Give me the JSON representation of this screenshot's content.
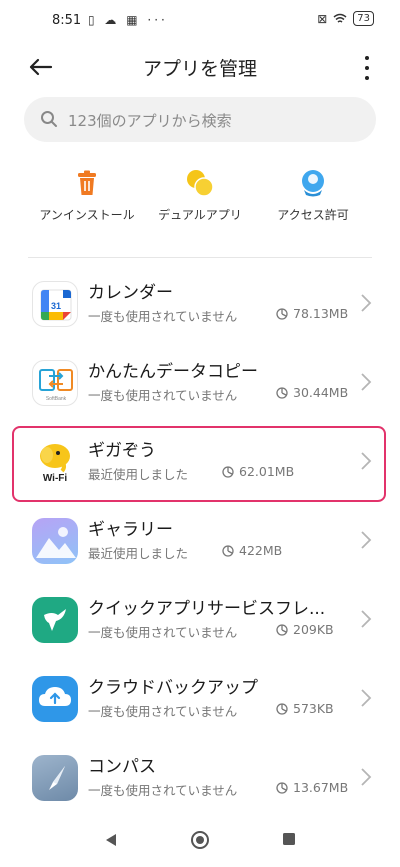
{
  "status_bar": {
    "time": "8:51",
    "left_icons": "▯ ☁ ▦ ···",
    "battery": "73"
  },
  "header": {
    "title": "アプリを管理"
  },
  "search": {
    "placeholder": "123個のアプリから検索"
  },
  "quick_actions": [
    {
      "label": "アンインストール",
      "icon": "trash-icon",
      "color": "#f07a22"
    },
    {
      "label": "デュアルアプリ",
      "icon": "dual-circles-icon",
      "color": "#f5c518"
    },
    {
      "label": "アクセス許可",
      "icon": "access-badge-icon",
      "color": "#3fa7ee"
    }
  ],
  "apps": [
    {
      "name": "カレンダー",
      "last_used": "一度も使用されていません",
      "size": "78.13MB",
      "icon": "calendar-app-icon",
      "icon_text": "31"
    },
    {
      "name": "かんたんデータコピー",
      "last_used": "一度も使用されていません",
      "size": "30.44MB",
      "icon": "data-copy-app-icon",
      "icon_text": "SoftBank"
    },
    {
      "name": "ギガぞう",
      "last_used": "最近使用しました",
      "size": "62.01MB",
      "icon": "gigazou-app-icon",
      "icon_text": "Wi-Fi"
    },
    {
      "name": "ギャラリー",
      "last_used": "最近使用しました",
      "size": "422MB",
      "icon": "gallery-app-icon"
    },
    {
      "name": "クイックアプリサービスフレ...",
      "last_used": "一度も使用されていません",
      "size": "209KB",
      "icon": "quick-app-icon"
    },
    {
      "name": "クラウドバックアップ",
      "last_used": "一度も使用されていません",
      "size": "573KB",
      "icon": "cloud-backup-app-icon"
    },
    {
      "name": "コンパス",
      "last_used": "一度も使用されていません",
      "size": "13.67MB",
      "icon": "compass-app-icon"
    }
  ],
  "colors": {
    "highlight": "#e2336b",
    "secondary_text": "#777777"
  }
}
